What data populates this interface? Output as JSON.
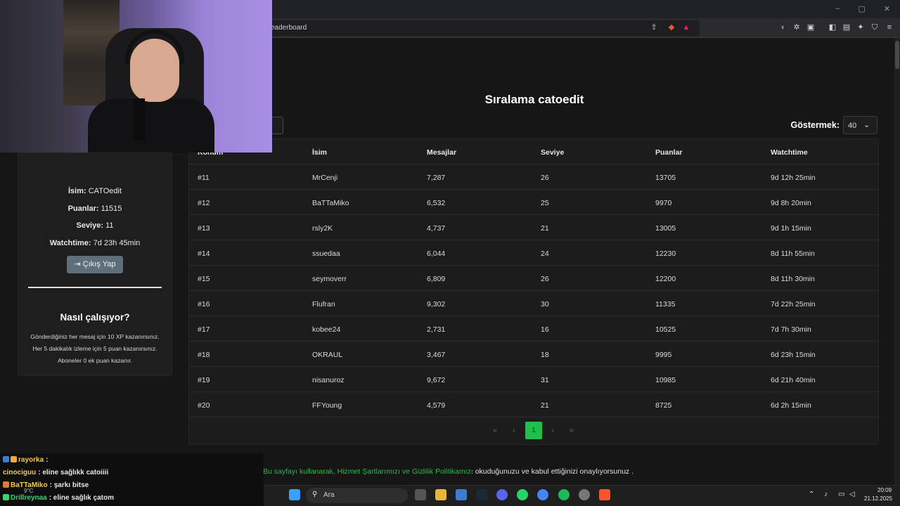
{
  "browser": {
    "url": "eaderboard",
    "window_controls": [
      "–",
      "▢",
      "✕"
    ]
  },
  "page": {
    "title": "Sıralama catoedit",
    "show_label": "Göstermek:",
    "show_value": "40"
  },
  "table": {
    "headers": [
      "Konum",
      "İsim",
      "Mesajlar",
      "Seviye",
      "Puanlar",
      "Watchtime"
    ],
    "rows": [
      [
        "#11",
        "MrCenji",
        "7,287",
        "26",
        "13705",
        "9d 12h 25min"
      ],
      [
        "#12",
        "BaTTaMiko",
        "6,532",
        "25",
        "9970",
        "9d 8h 20min"
      ],
      [
        "#13",
        "rsly2K",
        "4,737",
        "21",
        "13005",
        "9d 1h 15min"
      ],
      [
        "#14",
        "ssuedaa",
        "6,044",
        "24",
        "12230",
        "8d 11h 55min"
      ],
      [
        "#15",
        "seymoverr",
        "6,809",
        "26",
        "12200",
        "8d 11h 30min"
      ],
      [
        "#16",
        "Flufran",
        "9,302",
        "30",
        "11335",
        "7d 22h 25min"
      ],
      [
        "#17",
        "kobee24",
        "2,731",
        "16",
        "10525",
        "7d 7h 30min"
      ],
      [
        "#18",
        "OKRAUL",
        "3,467",
        "18",
        "9995",
        "6d 23h 15min"
      ],
      [
        "#19",
        "nisanuroz",
        "9,672",
        "31",
        "10985",
        "6d 21h 40min"
      ],
      [
        "#20",
        "FFYoung",
        "4,579",
        "21",
        "8725",
        "6d 2h 15min"
      ]
    ]
  },
  "pagination": {
    "first": "«",
    "prev": "‹",
    "current": "1",
    "next": "›",
    "last": "»"
  },
  "profile": {
    "name_label": "İsim:",
    "name_value": "CATOedit",
    "points_label": "Puanlar:",
    "points_value": "11515",
    "level_label": "Seviye:",
    "level_value": "11",
    "watchtime_label": "Watchtime:",
    "watchtime_value": "7d 23h 45min",
    "logout_label": "Çıkış Yap"
  },
  "how": {
    "title": "Nasıl çalışıyor?",
    "lines": [
      "Gönderdiğiniz her mesaj için 10 XP kazanırsınız.",
      "Her 5 dakikalık izleme için 5 puan kazanırsınız.",
      "Aboneler 0 ek puan kazanır."
    ]
  },
  "footer": {
    "prefix": "Bu sayfayı kullanarak, ",
    "terms": "Hizmet Şartlarımızı",
    "and": " ve ",
    "privacy": "Gizlilik Politikamızı",
    "suffix": " okuduğunuzu ve kabul ettiğinizi onaylıyorsunuz ."
  },
  "chat": [
    {
      "user": "rayorka",
      "message": ":",
      "user_color": "#f2c94c"
    },
    {
      "user": "cinociguu",
      "message": ": eline sağlıkk catoiiii",
      "user_color": "#f2c94c"
    },
    {
      "user": "BaTTaMiko",
      "message": ": şarkı bitse",
      "user_color": "#f2c94c"
    },
    {
      "user": "Drillreynaa",
      "message": ": eline sağlık çatom",
      "user_color": "#3bd16f"
    }
  ],
  "taskbar": {
    "search_placeholder": "Ara",
    "time": "20:09",
    "date": "21.12.2025",
    "weather": "9°C"
  },
  "colors": {
    "accent": "#1fbf4e",
    "background": "#161616",
    "button": "#5f6f7a"
  }
}
